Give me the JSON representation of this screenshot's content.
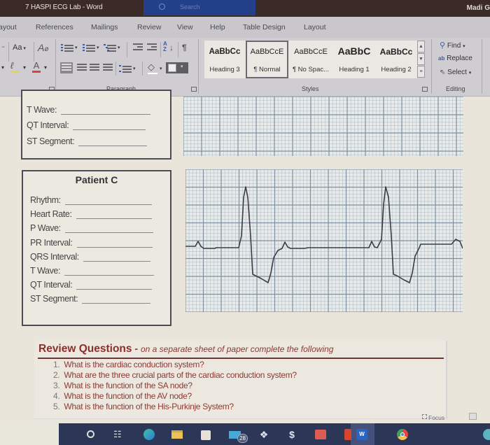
{
  "window": {
    "title": "7 HASPI ECG Lab  -  Word",
    "search_placeholder": "Search",
    "user": "Madi G"
  },
  "tabs": [
    "ayout",
    "References",
    "Mailings",
    "Review",
    "View",
    "Help",
    "Table Design",
    "Layout"
  ],
  "ribbon": {
    "font": {
      "change_case": "Aa",
      "clear_format_icon": "clear-formatting-icon",
      "highlight_icon": "highlighter-icon",
      "font_color_label": "A"
    },
    "paragraph_label": "Paragraph",
    "sort_label": "A↓Z",
    "pilcrow": "¶",
    "styles_label": "Styles",
    "styles": [
      {
        "preview": "AaBbCc",
        "name": "Heading 3"
      },
      {
        "preview": "AaBbCcE",
        "name": "¶ Normal",
        "selected": true
      },
      {
        "preview": "AaBbCcE",
        "name": "¶ No Spac..."
      },
      {
        "preview": "AaBbC",
        "name": "Heading 1"
      },
      {
        "preview": "AaBbCc",
        "name": "Heading 2"
      }
    ],
    "editing_label": "Editing",
    "editing": {
      "find": "Find",
      "replace": "Replace",
      "select": "Select"
    }
  },
  "patient_b": {
    "fields": [
      {
        "label": "T Wave:"
      },
      {
        "label": "QT Interval:"
      },
      {
        "label": "ST Segment:"
      }
    ]
  },
  "patient_c": {
    "title": "Patient C",
    "fields": [
      {
        "label": "Rhythm:"
      },
      {
        "label": "Heart Rate:"
      },
      {
        "label": "P Wave:"
      },
      {
        "label": "PR Interval:"
      },
      {
        "label": "QRS Interval:"
      },
      {
        "label": "T Wave:"
      },
      {
        "label": "QT Interval:"
      },
      {
        "label": "ST Segment:"
      }
    ]
  },
  "ecg_strip": {
    "description": "Patient C rhythm strip: two wide QRS complexes with P waves",
    "trace_color": "#3c3c44",
    "grid_color": "#7b8c9a"
  },
  "review": {
    "title": "Review Questions",
    "dash": " - ",
    "subtitle": "on a separate sheet of paper complete the following",
    "questions": [
      {
        "n": "1.",
        "text": "What is the cardiac conduction system?"
      },
      {
        "n": "2.",
        "text": "What are the three crucial parts of the cardiac conduction system?"
      },
      {
        "n": "3.",
        "text": "What is the function of the SA node?"
      },
      {
        "n": "4.",
        "text": "What is the function of the AV node?"
      },
      {
        "n": "5.",
        "text": "What is the function of the His-Purkinje System?"
      }
    ]
  },
  "statusbar": {
    "focus": "Focus"
  },
  "taskbar": {
    "items": [
      "cortana",
      "task-view",
      "edge",
      "file-explorer",
      "store",
      "mail",
      "dropbox",
      "app-s",
      "office-mail",
      "office",
      "word",
      "chrome"
    ],
    "mail_badge": "28"
  },
  "colors": {
    "titlebar": "#3b2a25",
    "search": "#23418a",
    "review_title": "#8a2f2a",
    "taskbar": "#2c3657"
  }
}
